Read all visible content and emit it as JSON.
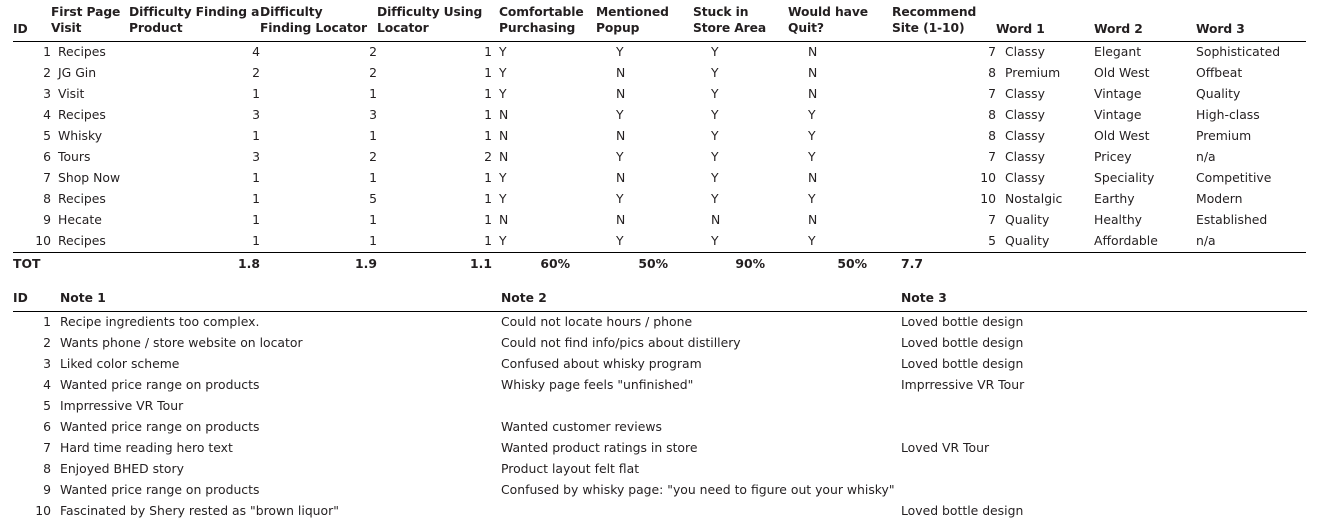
{
  "table_one": {
    "name": "usability-study-results",
    "columns": [
      {
        "key": "id",
        "label": "ID",
        "align": "right"
      },
      {
        "key": "first",
        "label": "First Page Visit",
        "align": "left"
      },
      {
        "key": "diff_prod",
        "label": "Difficulty Finding a Product",
        "align": "right"
      },
      {
        "key": "diff_loc",
        "label": "Difficulty Finding Locator",
        "align": "right"
      },
      {
        "key": "use_loc",
        "label": "Difficulty Using Locator",
        "align": "right"
      },
      {
        "key": "comf",
        "label": "Comfortable Purchasing",
        "align": "left"
      },
      {
        "key": "popup",
        "label": "Mentioned Popup",
        "align": "left"
      },
      {
        "key": "stuck",
        "label": "Stuck in Store Area",
        "align": "left"
      },
      {
        "key": "quit",
        "label": "Would have Quit?",
        "align": "left"
      },
      {
        "key": "rec",
        "label": "Recommend Site (1-10)",
        "align": "right"
      },
      {
        "key": "word1",
        "label": "Word 1",
        "align": "left"
      },
      {
        "key": "word2",
        "label": "Word 2",
        "align": "left"
      },
      {
        "key": "word3",
        "label": "Word 3",
        "align": "left"
      }
    ],
    "rows": [
      {
        "id": "1",
        "first": "Recipes",
        "diff_prod": "4",
        "diff_loc": "2",
        "use_loc": "1",
        "comf": "Y",
        "popup": "Y",
        "stuck": "Y",
        "quit": "N",
        "rec": "7",
        "word1": "Classy",
        "word2": "Elegant",
        "word3": "Sophisticated"
      },
      {
        "id": "2",
        "first": "JG Gin",
        "diff_prod": "2",
        "diff_loc": "2",
        "use_loc": "1",
        "comf": "Y",
        "popup": "N",
        "stuck": "Y",
        "quit": "N",
        "rec": "8",
        "word1": "Premium",
        "word2": "Old West",
        "word3": "Offbeat"
      },
      {
        "id": "3",
        "first": "Visit",
        "diff_prod": "1",
        "diff_loc": "1",
        "use_loc": "1",
        "comf": "Y",
        "popup": "N",
        "stuck": "Y",
        "quit": "N",
        "rec": "7",
        "word1": "Classy",
        "word2": "Vintage",
        "word3": "Quality"
      },
      {
        "id": "4",
        "first": "Recipes",
        "diff_prod": "3",
        "diff_loc": "3",
        "use_loc": "1",
        "comf": "N",
        "popup": "Y",
        "stuck": "Y",
        "quit": "Y",
        "rec": "8",
        "word1": "Classy",
        "word2": "Vintage",
        "word3": "High-class"
      },
      {
        "id": "5",
        "first": "Whisky",
        "diff_prod": "1",
        "diff_loc": "1",
        "use_loc": "1",
        "comf": "N",
        "popup": "N",
        "stuck": "Y",
        "quit": "Y",
        "rec": "8",
        "word1": "Classy",
        "word2": "Old West",
        "word3": "Premium"
      },
      {
        "id": "6",
        "first": "Tours",
        "diff_prod": "3",
        "diff_loc": "2",
        "use_loc": "2",
        "comf": "N",
        "popup": "Y",
        "stuck": "Y",
        "quit": "Y",
        "rec": "7",
        "word1": "Classy",
        "word2": "Pricey",
        "word3": "n/a"
      },
      {
        "id": "7",
        "first": "Shop Now",
        "diff_prod": "1",
        "diff_loc": "1",
        "use_loc": "1",
        "comf": "Y",
        "popup": "N",
        "stuck": "Y",
        "quit": "N",
        "rec": "10",
        "word1": "Classy",
        "word2": "Speciality",
        "word3": "Competitive"
      },
      {
        "id": "8",
        "first": "Recipes",
        "diff_prod": "1",
        "diff_loc": "5",
        "use_loc": "1",
        "comf": "Y",
        "popup": "Y",
        "stuck": "Y",
        "quit": "Y",
        "rec": "10",
        "word1": "Nostalgic",
        "word2": "Earthy",
        "word3": "Modern"
      },
      {
        "id": "9",
        "first": "Hecate",
        "diff_prod": "1",
        "diff_loc": "1",
        "use_loc": "1",
        "comf": "N",
        "popup": "N",
        "stuck": "N",
        "quit": "N",
        "rec": "7",
        "word1": "Quality",
        "word2": "Healthy",
        "word3": "Established"
      },
      {
        "id": "10",
        "first": "Recipes",
        "diff_prod": "1",
        "diff_loc": "1",
        "use_loc": "1",
        "comf": "Y",
        "popup": "Y",
        "stuck": "Y",
        "quit": "Y",
        "rec": "5",
        "word1": "Quality",
        "word2": "Affordable",
        "word3": "n/a"
      }
    ],
    "totals": {
      "label": "TOT",
      "first": "",
      "diff_prod": "1.8",
      "diff_loc": "1.9",
      "use_loc": "1.1",
      "comf": "60%",
      "popup": "50%",
      "stuck": "90%",
      "quit": "50%",
      "rec": "7.7",
      "word1": "",
      "word2": "",
      "word3": ""
    }
  },
  "table_two": {
    "name": "usability-study-notes",
    "columns": [
      {
        "key": "id",
        "label": "ID"
      },
      {
        "key": "note1",
        "label": "Note 1"
      },
      {
        "key": "note2",
        "label": "Note 2"
      },
      {
        "key": "note3",
        "label": "Note 3"
      }
    ],
    "rows": [
      {
        "id": "1",
        "note1": "Recipe ingredients too complex.",
        "note2": "Could not locate hours / phone",
        "note3": "Loved bottle design"
      },
      {
        "id": "2",
        "note1": "Wants phone / store website on locator",
        "note2": "Could not find info/pics about distillery",
        "note3": "Loved bottle design"
      },
      {
        "id": "3",
        "note1": "Liked color scheme",
        "note2": "Confused about whisky program",
        "note3": "Loved bottle design"
      },
      {
        "id": "4",
        "note1": "Wanted price range on products",
        "note2": "Whisky page feels \"unfinished\"",
        "note3": "Imprressive VR Tour"
      },
      {
        "id": "5",
        "note1": "Imprressive VR Tour",
        "note2": "",
        "note3": ""
      },
      {
        "id": "6",
        "note1": "Wanted price range on products",
        "note2": "Wanted customer reviews",
        "note3": ""
      },
      {
        "id": "7",
        "note1": "Hard time reading hero text",
        "note2": "Wanted product ratings in store",
        "note3": "Loved VR Tour"
      },
      {
        "id": "8",
        "note1": "Enjoyed BHED story",
        "note2": "Product layout felt flat",
        "note3": ""
      },
      {
        "id": "9",
        "note1": "Wanted price range on products",
        "note2": "Confused by whisky page: \"you need to figure out your whisky\"",
        "note3": ""
      },
      {
        "id": "10",
        "note1": "Fascinated by Shery rested as \"brown liquor\"",
        "note2": "",
        "note3": "Loved bottle design"
      }
    ]
  },
  "style": {
    "text_color": "#231f20",
    "rule_color": "#000000",
    "background": "#ffffff"
  }
}
